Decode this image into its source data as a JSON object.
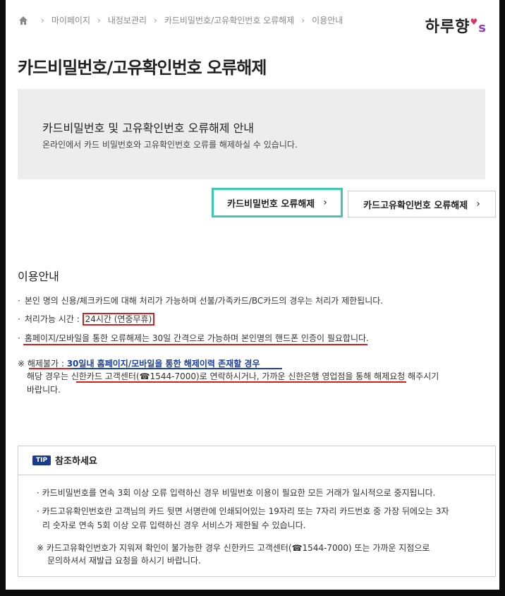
{
  "breadcrumb": {
    "items": [
      "마이페이지",
      "내정보관리",
      "카드비밀번호/고유확인번호 오류해제",
      "이용안내"
    ]
  },
  "logo": {
    "text": "하루향",
    "suffix": "s"
  },
  "page_title": "카드비밀번호/고유확인번호 오류해제",
  "info": {
    "heading": "카드비밀번호 및 고유확인번호 오류해제 안내",
    "desc": "온라인에서 카드 비밀번호와 고유확인번호 오류를 해제하실 수 있습니다."
  },
  "buttons": {
    "pw_label": "카드비밀번호 오류해제",
    "uid_label": "카드고유확인번호 오류해제"
  },
  "usage": {
    "title": "이용안내",
    "line1": "본인 명의 신용/체크카드에 대해 처리가 가능하며 선불/가족카드/BC카드의 경우는 처리가 제한됩니다.",
    "line2_label": "처리가능 시간 : ",
    "line2_value": "24시간 (연중무휴)",
    "line3": "홈페이지/모바일을 통한 오류해제는 30일 간격으로 가능하며 본인명의 핸드폰 인증이 필요합니다.",
    "note_prefix": "※ 해제불가 : ",
    "note_highlight": "30일내 홈페이지/모바일을 통한 해제이력 존재할 경우",
    "note_line2": "해당 경우는 신한카드 고객센터(☎1544-7000)로 연락하시거나, 가까운 신한은행 영업점을 통해 해제요청 해주시기",
    "note_line3": "바랍니다."
  },
  "tip": {
    "badge": "TIP",
    "title": "참조하세요",
    "line1": "카드비밀번호를 연속 3회 이상 오류 입력하신 경우 비밀번호 이용이 필요한 모든 거래가 일시적으로 중지됩니다.",
    "line2a": "카드고유확인번호란 고객님의 카드 뒷면 서명란에 인쇄되어있는 19자리 또는 7자리 카드번호 중 가장 뒤에오는 3자",
    "line2b": "리 숫자로 연속 5회 이상 오류 입력하신 경우 서비스가 제한될 수 있습니다.",
    "note_a": "※ 카드고유확인번호가 지워져 확인이 불가능한 경우 신한카드 고객센터(☎1544-7000) 또는 가까운 지점으로",
    "note_b": "문의하셔서 재발급 요청을 하시기 바랍니다."
  },
  "colors": {
    "highlight_box": "#d21f1f",
    "button_focus": "#3cc9b0",
    "tip_badge": "#1a3a8f"
  }
}
